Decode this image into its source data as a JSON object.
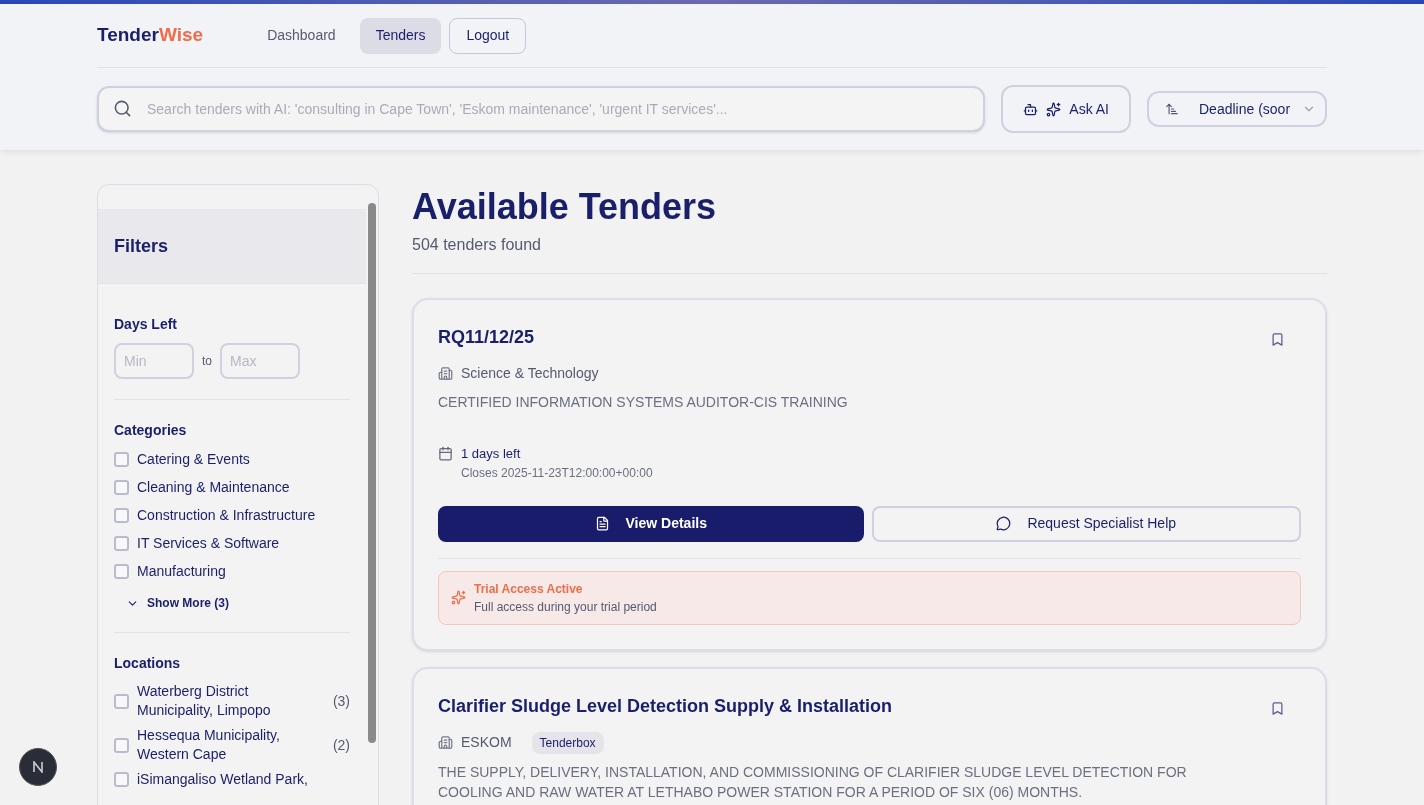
{
  "logo": {
    "part_1": "Tender",
    "part_2": "Wise"
  },
  "nav": [
    {
      "label": "Dashboard",
      "selected": false,
      "kind": "link"
    },
    {
      "label": "Tenders",
      "selected": true,
      "kind": "link"
    },
    {
      "label": "Logout",
      "selected": false,
      "kind": "outline"
    }
  ],
  "search": {
    "placeholder": "Search tenders with AI: 'consulting in Cape Town', 'Eskom maintenance', 'urgent IT services'..."
  },
  "ask_ai": {
    "label": "Ask AI"
  },
  "sort": {
    "value": "Deadline (soor"
  },
  "filters": {
    "title": "Filters",
    "days_left": {
      "label": "Days Left",
      "min_placeholder": "Min",
      "separator": "to",
      "max_placeholder": "Max"
    },
    "categories": {
      "label": "Categories",
      "items": [
        {
          "label": "Catering & Events",
          "checked": false
        },
        {
          "label": "Cleaning & Maintenance",
          "checked": false
        },
        {
          "label": "Construction & Infrastructure",
          "checked": false
        },
        {
          "label": "IT Services & Software",
          "checked": false
        },
        {
          "label": "Manufacturing",
          "checked": false
        }
      ],
      "show_more": "Show More (3)"
    },
    "locations": {
      "label": "Locations",
      "items": [
        {
          "label": "Waterberg District Municipality, Limpopo",
          "count": "(3)",
          "checked": false
        },
        {
          "label": "Hessequa Municipality, Western Cape",
          "count": "(2)",
          "checked": false
        },
        {
          "label": "iSimangaliso Wetland Park,",
          "checked": false
        }
      ]
    }
  },
  "main": {
    "title": "Available Tenders",
    "count": "504 tenders found",
    "tenders": [
      {
        "title": "RQ11/12/25",
        "org": "Science & Technology",
        "description": "CERTIFIED INFORMATION SYSTEMS AUDITOR-CIS TRAINING",
        "days_left": "1 days left",
        "closes": "Closes 2025-11-23T12:00:00+00:00",
        "view": "View Details",
        "help": "Request Specialist Help",
        "notice_title": "Trial Access Active",
        "notice_text": "Full access during your trial period"
      },
      {
        "title": "Clarifier Sludge Level Detection Supply & Installation",
        "org": "ESKOM",
        "tag": "Tenderbox",
        "description": "THE SUPPLY, DELIVERY, INSTALLATION, AND COMMISSIONING OF CLARIFIER SLUDGE LEVEL DETECTION FOR COOLING AND RAW WATER AT LETHABO POWER STATION FOR A PERIOD OF SIX (06) MONTHS."
      }
    ]
  }
}
